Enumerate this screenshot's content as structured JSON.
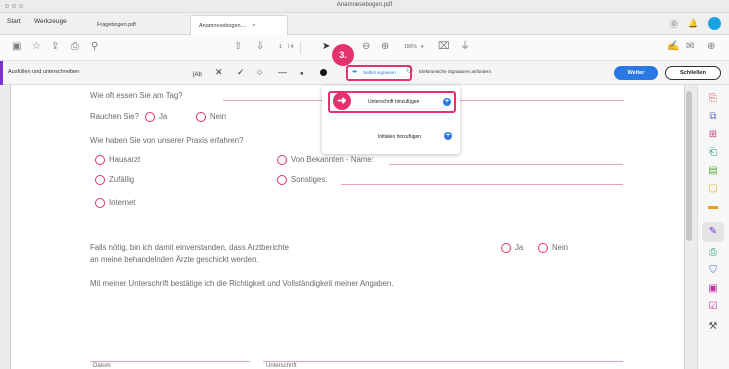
{
  "window": {
    "title": "Anamnesebogen.pdf"
  },
  "tabs": {
    "start": "Start",
    "tools": "Werkzeuge",
    "doc1": "Fragebogen.pdf",
    "doc2": "Anamnesebogen....",
    "close": "×"
  },
  "toolbar": {
    "page_current": "1",
    "page_total": "/ 4",
    "zoom": "150%"
  },
  "signbar": {
    "title": "Ausfüllen und unterschreiben",
    "text_tool": "|Ab",
    "self_sign": "Selbst signieren",
    "request_esign": "Elektronische Signaturen anfordern",
    "next": "Weiter",
    "close": "Schließen"
  },
  "step_badge": "3.",
  "menu": {
    "add_signature": "Unterschrift hinzufügen",
    "add_initials": "Initialen hinzufügen"
  },
  "form": {
    "q_meals": "Wie oft essen Sie am Tag?",
    "q_smoke": "Rauchen Sie?",
    "yes": "Ja",
    "no": "Nein",
    "q_source": "Wie haben Sie von unserer Praxis erfahren?",
    "opt_gp": "Hausarzt",
    "opt_acquaintance": "Von Bekannten - Name:",
    "opt_random": "Zufällig",
    "opt_other": "Sonstiges:",
    "opt_internet": "Internet",
    "consent_1": "Falls nötig, bin ich damit einverstanden, dass Arztberichte",
    "consent_2": "an meine behandelnden Ärzte geschickt werden.",
    "confirm": "Mit meiner Unterschrift bestätige ich die Richtigkeit und Vollständigkeit meiner Angaben.",
    "date_label": "Datum",
    "signature_label": "Unterschrift"
  },
  "colors": {
    "accent": "#e4326e",
    "brand_purple": "#7b2fd6",
    "primary_blue": "#2a78e4"
  }
}
